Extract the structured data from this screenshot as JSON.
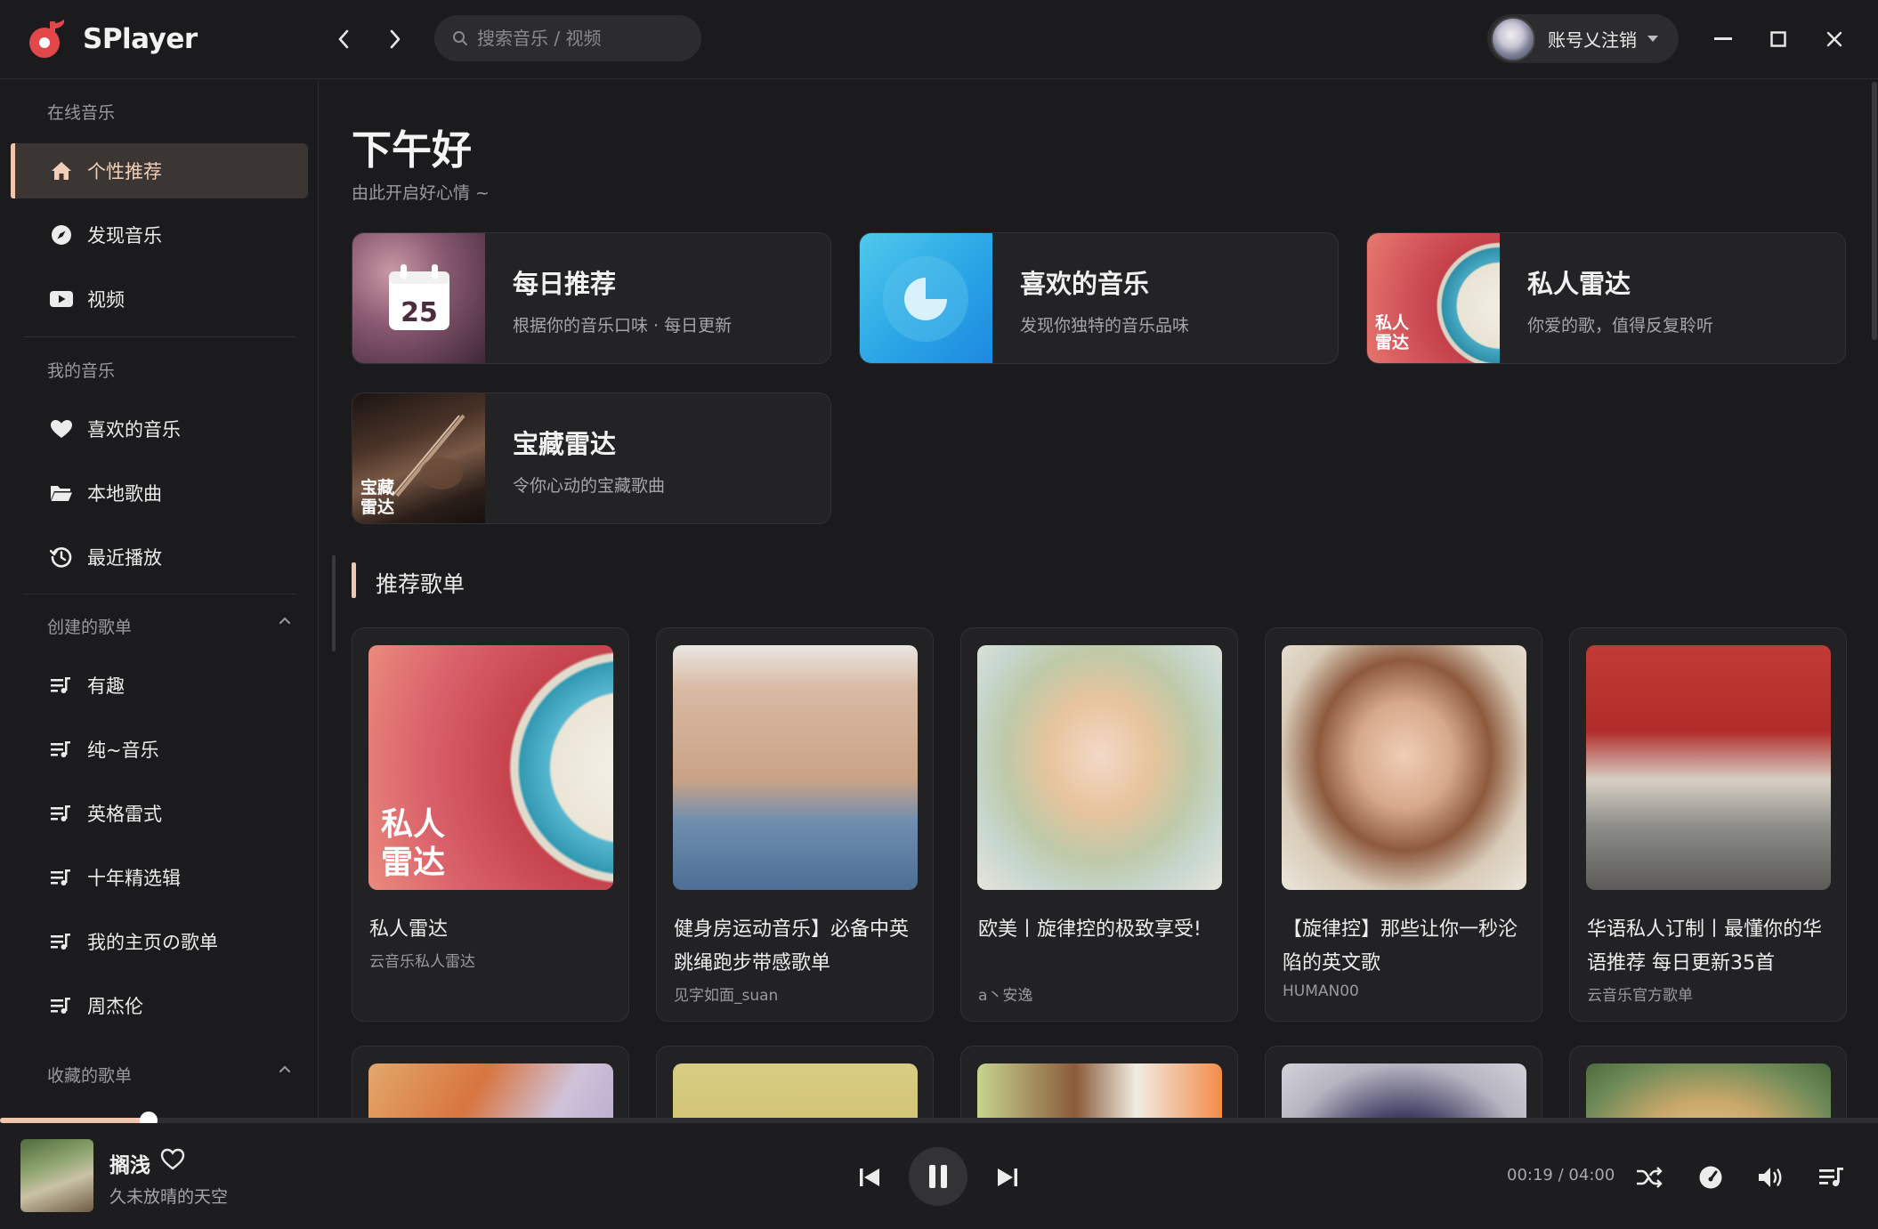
{
  "app": {
    "name": "SPlayer",
    "brand_color": "#e2474a",
    "accent_color": "#f0c7ae"
  },
  "search": {
    "placeholder": "搜索音乐 / 视频"
  },
  "account": {
    "name": "账号乂注销"
  },
  "sidebar": {
    "online_title": "在线音乐",
    "online_items": [
      {
        "label": "个性推荐",
        "icon": "home-icon",
        "active": true
      },
      {
        "label": "发现音乐",
        "icon": "compass-icon"
      },
      {
        "label": "视频",
        "icon": "video-icon"
      }
    ],
    "mine_title": "我的音乐",
    "mine_items": [
      {
        "label": "喜欢的音乐",
        "icon": "heart-icon"
      },
      {
        "label": "本地歌曲",
        "icon": "folder-icon"
      },
      {
        "label": "最近播放",
        "icon": "history-icon"
      }
    ],
    "created_title": "创建的歌单",
    "created_items": [
      {
        "label": "有趣"
      },
      {
        "label": "纯~音乐"
      },
      {
        "label": "英格雷式"
      },
      {
        "label": "十年精选辑"
      },
      {
        "label": "我的主页の歌单"
      },
      {
        "label": "周杰伦"
      }
    ],
    "collected_title": "收藏的歌单"
  },
  "main": {
    "greeting": "下午好",
    "greeting_sub": "由此开启好心情 ~",
    "features": [
      {
        "title": "每日推荐",
        "desc": "根据你的音乐口味 · 每日更新",
        "day": "25"
      },
      {
        "title": "喜欢的音乐",
        "desc": "发现你独特的音乐品味"
      },
      {
        "title": "私人雷达",
        "desc": "你爱的歌，值得反复聆听",
        "cover_text": "私人\n雷达"
      },
      {
        "title": "宝藏雷达",
        "desc": "令你心动的宝藏歌曲",
        "cover_text": "宝藏\n雷达"
      }
    ],
    "section_title": "推荐歌单",
    "playlists": [
      {
        "title": "私人雷达",
        "sub": "云音乐私人雷达",
        "cover_text": "私人\n雷达"
      },
      {
        "title": "健身房运动音乐】必备中英跳绳跑步带感歌单",
        "sub": "见字如面_suan"
      },
      {
        "title": "欧美丨旋律控的极致享受!",
        "sub": "a丶安逸"
      },
      {
        "title": "【旋律控】那些让你一秒沦陷的英文歌",
        "sub": "HUMAN00"
      },
      {
        "title": "华语私人订制丨最懂你的华语推荐 每日更新35首",
        "sub": "云音乐官方歌单"
      }
    ]
  },
  "player": {
    "title": "搁浅",
    "artist": "久未放晴的天空",
    "current_time": "00:19",
    "separator": "/",
    "total_time": "04:00",
    "progress_fraction": 0.079
  }
}
